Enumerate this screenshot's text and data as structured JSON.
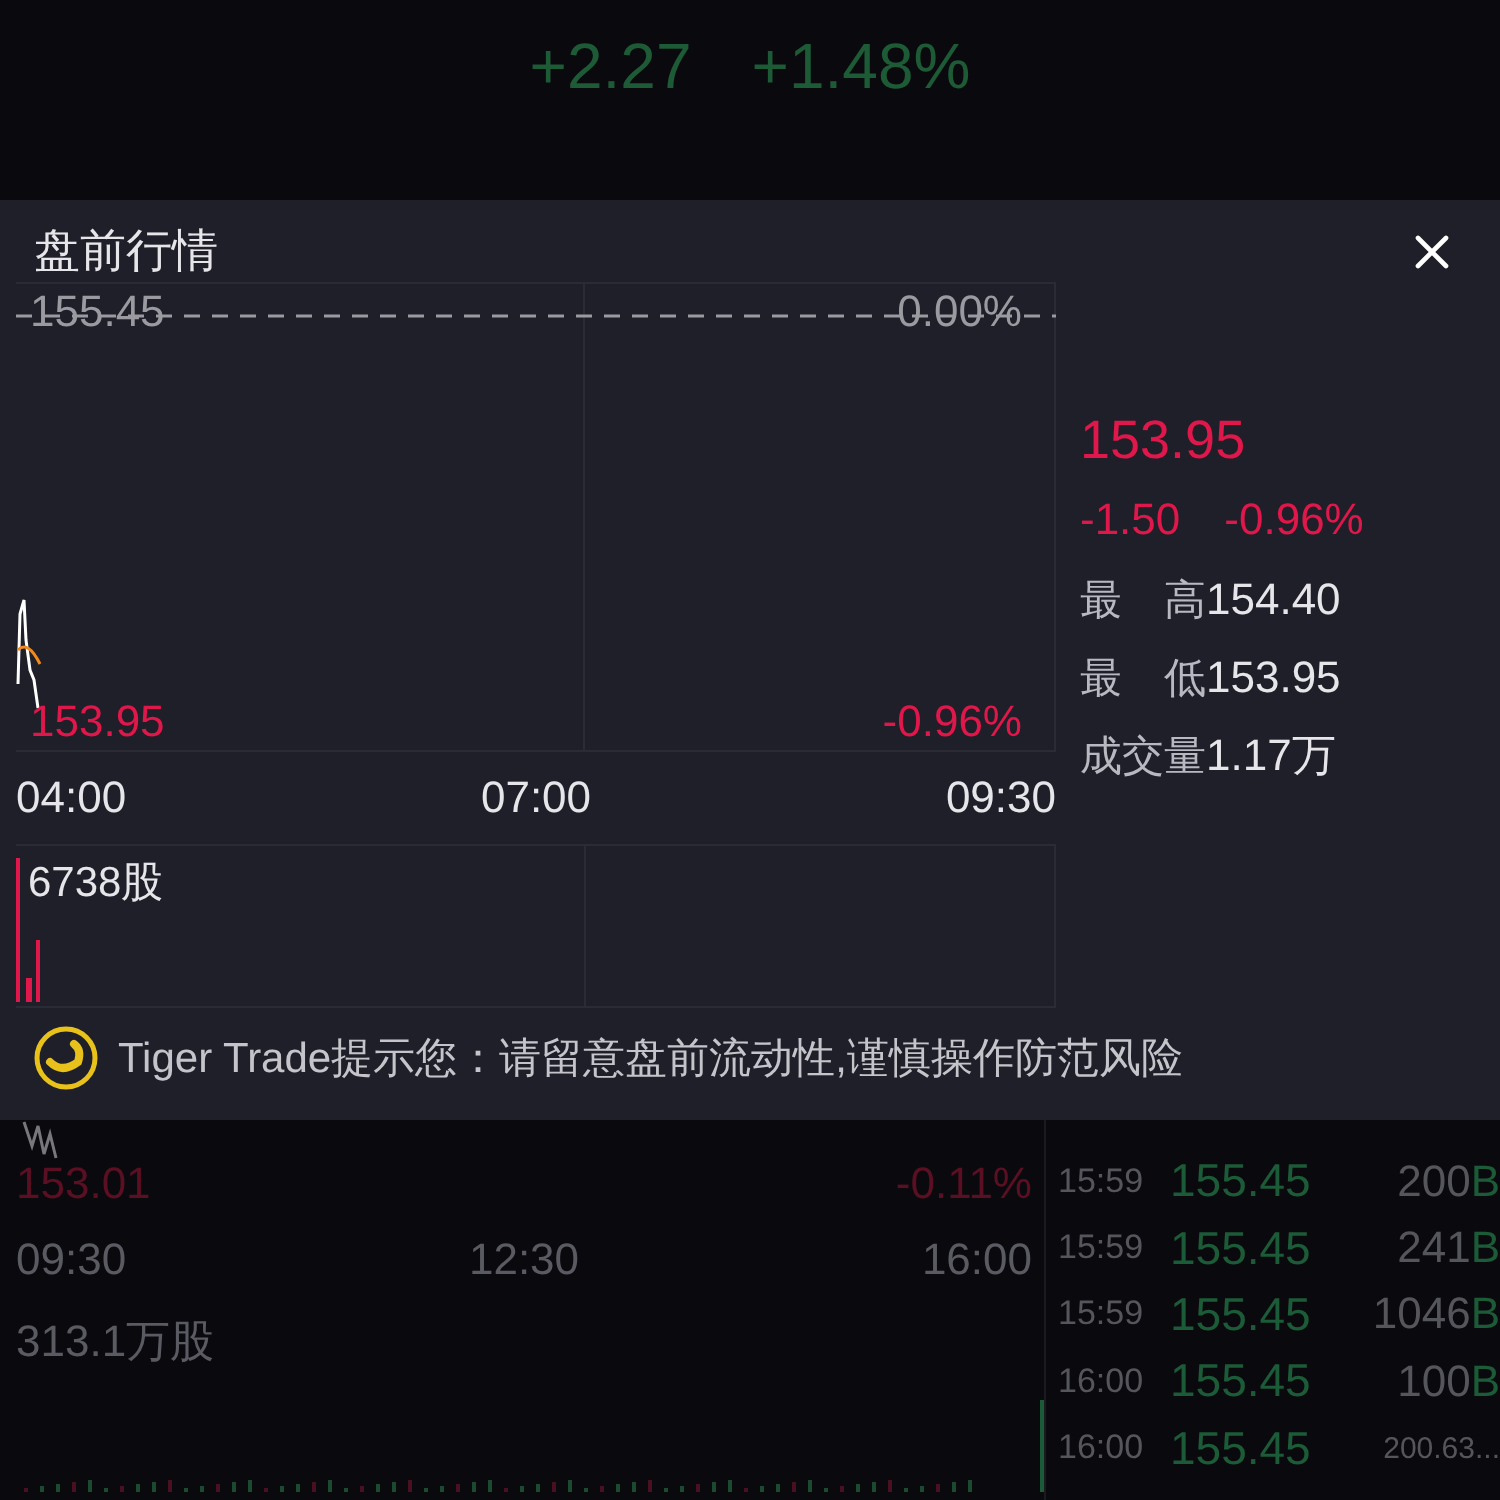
{
  "header": {
    "change": "+2.27",
    "change_percent": "+1.48%"
  },
  "premarket_panel": {
    "title": "盘前行情",
    "chart": {
      "top_price": "155.45",
      "top_percent": "0.00%",
      "bottom_price": "153.95",
      "bottom_percent": "-0.96%",
      "times": [
        "04:00",
        "07:00",
        "09:30"
      ],
      "volume": "6738股"
    },
    "quote": {
      "price": "153.95",
      "change": "-1.50",
      "change_percent": "-0.96%",
      "stats": [
        {
          "label": "最　高",
          "value": "154.40"
        },
        {
          "label": "最　低",
          "value": "153.95"
        },
        {
          "label": "成交量",
          "value": "1.17万"
        }
      ]
    },
    "notice": "Tiger Trade提示您：请留意盘前流动性,谨慎操作防范风险"
  },
  "intraday": {
    "bottom_price": "153.01",
    "bottom_percent": "-0.11%",
    "times": [
      "09:30",
      "12:30",
      "16:00"
    ],
    "volume": "313.1万股"
  },
  "trades": [
    {
      "time": "15:59",
      "price": "155.45",
      "volume": "200",
      "side": "B"
    },
    {
      "time": "15:59",
      "price": "155.45",
      "volume": "241",
      "side": "B"
    },
    {
      "time": "15:59",
      "price": "155.45",
      "volume": "1046",
      "side": "B"
    },
    {
      "time": "16:00",
      "price": "155.45",
      "volume": "100",
      "side": "B"
    },
    {
      "time": "16:00",
      "price": "155.45",
      "volume": "200.63..."
    }
  ]
}
